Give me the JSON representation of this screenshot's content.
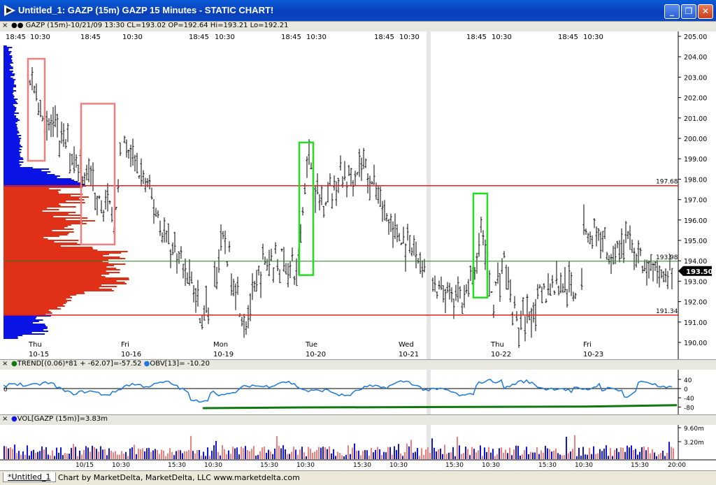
{
  "window": {
    "title": "Untitled_1: GAZP (15m) GAZP 15 Minutes - STATIC CHART!",
    "minimize_label": "_",
    "maximize_label": "❐",
    "close_label": "✕"
  },
  "price_panel": {
    "header": "GAZP (15m)-10/21/09 13:30 CL=193.02 OP=192.64 Hi=193.21 Lo=192.21",
    "close_marker": "×",
    "top_times": [
      "18:45",
      "10:30",
      "18:45",
      "10:30",
      "18:45",
      "10:30",
      "18:45",
      "10:30",
      "18:45",
      "10:30",
      "18:45",
      "10:30",
      "18:45",
      "10:30"
    ],
    "day_labels": [
      {
        "dow": "Thu",
        "date": "10-15"
      },
      {
        "dow": "Fri",
        "date": "10-16"
      },
      {
        "dow": "Mon",
        "date": "10-19"
      },
      {
        "dow": "Tue",
        "date": "10-20"
      },
      {
        "dow": "Wed",
        "date": "10-21"
      },
      {
        "dow": "Thu",
        "date": "10-22"
      },
      {
        "dow": "Fri",
        "date": "10-23"
      }
    ],
    "y_ticks": [
      "205.00",
      "204.00",
      "203.00",
      "202.00",
      "201.00",
      "200.00",
      "199.00",
      "198.00",
      "197.00",
      "196.00",
      "195.00",
      "194.00",
      "193.00",
      "192.00",
      "191.00",
      "190.00"
    ],
    "levels": [
      {
        "label": "197.68",
        "value": 197.68,
        "color": "#e02020"
      },
      {
        "label": "193.98",
        "value": 193.98,
        "color": "#208020"
      },
      {
        "label": "191.34",
        "value": 191.34,
        "color": "#e02020"
      }
    ],
    "last_price": "193.50",
    "colors": {
      "profile_upper": "#0a14e6",
      "profile_lower": "#e03018",
      "pink_box": "#f08080",
      "green_box": "#22dd22",
      "bars": "#000000"
    }
  },
  "trend_panel": {
    "header": "TREND[(0.06)*81 + -62.07]=-57.52",
    "header2": "OBV[13]= -10.20",
    "y_ticks": [
      "40",
      "0",
      "-40",
      "-80"
    ],
    "zero_label": "0",
    "colors": {
      "obv": "#1e78d8",
      "trend": "#117711"
    }
  },
  "volume_panel": {
    "header": "VOL[GAZP (15m)]=3.83m",
    "y_ticks": [
      "9.60m",
      "3.20m"
    ],
    "x_labels": [
      "10/15",
      "10:30",
      "15:30",
      "10:30",
      "15:30",
      "10:30",
      "15:30",
      "10:30",
      "15:30",
      "10:30",
      "15:30",
      "10:30",
      "15:30",
      "20:00"
    ],
    "colors": {
      "up": "#f08080",
      "down": "#1414e0"
    }
  },
  "status": {
    "tab_label": "*Untitled_1",
    "credit": "Chart by MarketDelta, MarketDelta, LLC www.marketdelta.com"
  }
}
